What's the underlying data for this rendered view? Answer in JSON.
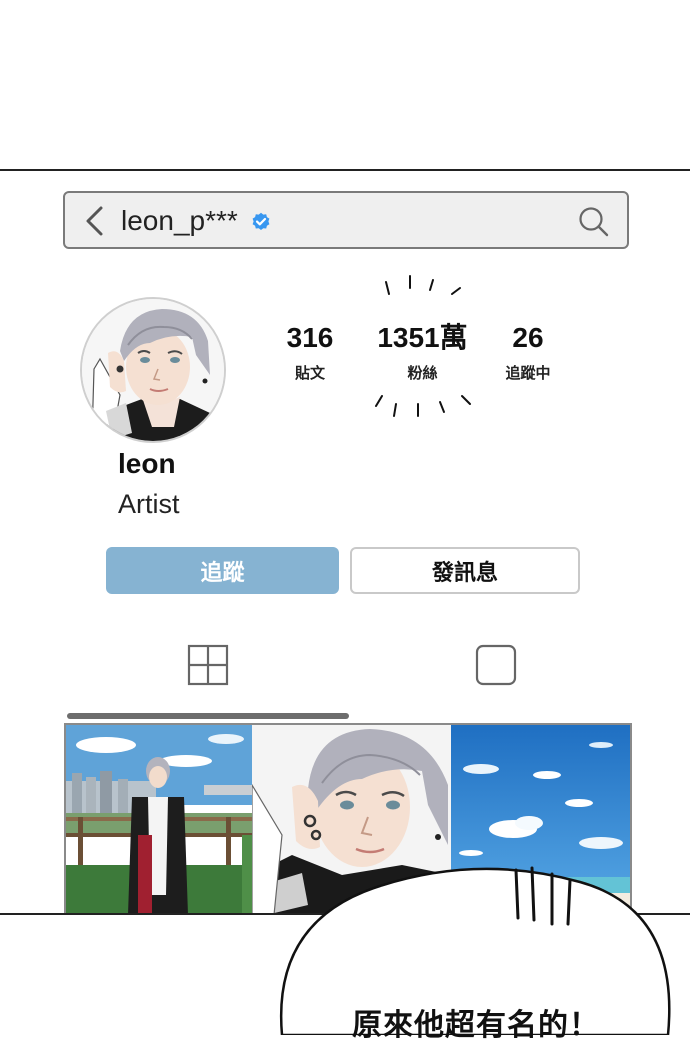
{
  "search": {
    "username": "leon_p***",
    "verified": true
  },
  "stats": [
    {
      "value": "316",
      "label": "貼文"
    },
    {
      "value": "1351萬",
      "label": "粉絲"
    },
    {
      "value": "26",
      "label": "追蹤中"
    }
  ],
  "profile": {
    "name": "leon",
    "bio": "Artist"
  },
  "buttons": {
    "follow": "追蹤",
    "message": "發訊息"
  },
  "icons": {
    "back": "chevron-left-icon",
    "verified": "verified-badge-icon",
    "search": "search-icon",
    "grid_tab": "grid-icon",
    "tagged_tab": "square-icon"
  },
  "tabs": {
    "active": "grid"
  },
  "colors": {
    "follow_button": "#86b3d2",
    "verified": "#3897f0"
  },
  "speech_bubble": {
    "text": "原來他超有名的！"
  }
}
